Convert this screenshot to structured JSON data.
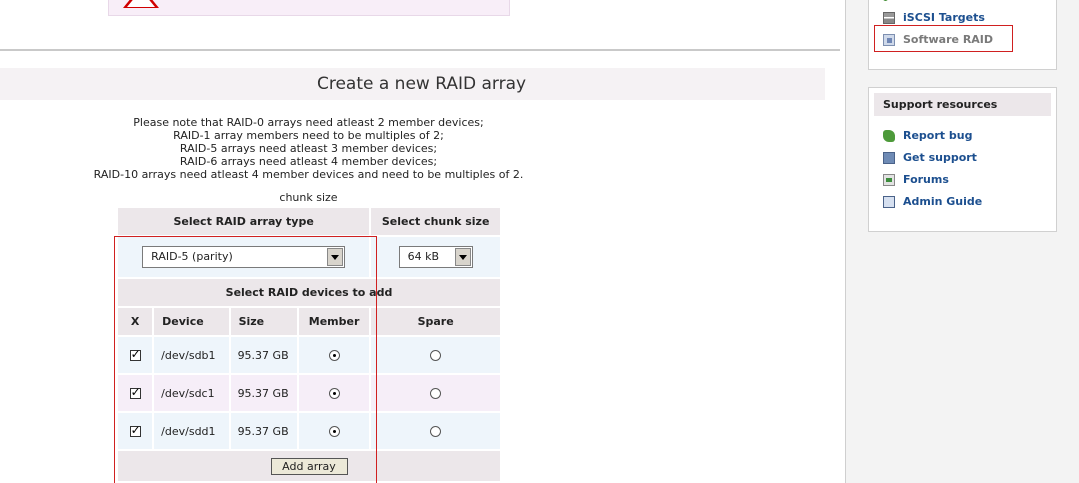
{
  "page": {
    "title": "Create a new RAID array",
    "notes": [
      "Please note that RAID-0 arrays need atleast 2 member devices;",
      "RAID-1 array members need to be multiples of 2;",
      "RAID-5 arrays need atleast 3 member devices;",
      "RAID-6 arrays need atleast 4 member devices;",
      "RAID-10 arrays need atleast 4 member devices and need to be multiples of 2."
    ],
    "chunk_caption": "chunk size"
  },
  "form": {
    "raid_type_header": "Select RAID array type",
    "chunk_size_header": "Select chunk size",
    "raid_type_value": "RAID-5 (parity)",
    "chunk_size_value": "64 kB",
    "devices_header": "Select RAID devices to add",
    "columns": [
      "X",
      "Device",
      "Size",
      "Member",
      "Spare"
    ],
    "devices": [
      {
        "device": "/dev/sdb1",
        "size": "95.37 GB",
        "selected": true,
        "role": "member"
      },
      {
        "device": "/dev/sdc1",
        "size": "95.37 GB",
        "selected": true,
        "role": "member"
      },
      {
        "device": "/dev/sdd1",
        "size": "95.37 GB",
        "selected": true,
        "role": "member"
      }
    ],
    "add_button": "Add array"
  },
  "sidebar": {
    "nav_items": [
      {
        "label": "iSCSI Targets",
        "icon": "storage-target-icon"
      },
      {
        "label": "Software RAID",
        "icon": "software-raid-icon"
      }
    ],
    "support_title": "Support resources",
    "support_items": [
      {
        "label": "Report bug",
        "icon": "bug-icon"
      },
      {
        "label": "Get support",
        "icon": "support-icon"
      },
      {
        "label": "Forums",
        "icon": "forum-icon"
      },
      {
        "label": "Admin Guide",
        "icon": "guide-book-icon"
      }
    ]
  },
  "colors": {
    "highlight_border": "#d02020",
    "link_blue": "#1c4f8f",
    "header_bg": "#ece7ea"
  }
}
